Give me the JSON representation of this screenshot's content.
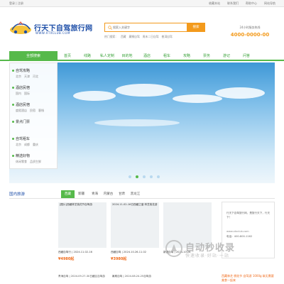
{
  "topbar": {
    "login": "登录 | 注册",
    "links": [
      "收藏本站",
      "联系我们",
      "帮助中心",
      "网站导航"
    ]
  },
  "logo": {
    "name": "行天下自驾旅行网",
    "url": "WWW.XTXCLUB.COM"
  },
  "search": {
    "placeholder": "搜索入关键字",
    "button": "搜索",
    "hot_label": "热门搜索：",
    "hot_terms": [
      "西藏",
      "藏桐自驾",
      "周末二日自驾",
      "普洱自驾"
    ]
  },
  "hotline": {
    "label": "24小时服务热线",
    "number": "4000-0000-00"
  },
  "nav": {
    "all_label": "全部搜索",
    "items": [
      "首页",
      "线路",
      "私人定制",
      "目的地",
      "酒店",
      "租车",
      "攻略",
      "票务",
      "游记",
      "问答"
    ]
  },
  "side_menu": [
    {
      "title": "自驾攻略",
      "subs": [
        "北京",
        "天津",
        "河北"
      ]
    },
    {
      "title": "酒店民宿",
      "subs": [
        "国内",
        "国际"
      ]
    },
    {
      "title": "酒店民宿",
      "subs": [
        "度假酒店",
        "民宿",
        "客栈"
      ]
    },
    {
      "title": "景点门票",
      "subs": []
    },
    {
      "title": "自驾租车",
      "subs": [
        "北京",
        "成都",
        "重庆"
      ]
    },
    {
      "title": "精选好物",
      "subs": [
        "休闲零食",
        "品质生鲜"
      ]
    }
  ],
  "section": {
    "title": "国内旅游",
    "tabs": [
      "西藏",
      "新疆",
      "青海",
      "内蒙古",
      "甘肃",
      "黑龙江"
    ],
    "active_tab": "西藏"
  },
  "cards": [
    {
      "caption": "[图片]西藏林芝桃花节自驾游",
      "desc": "西藏自驾行 | 2024.11.02-16",
      "price": "¥4980起"
    },
    {
      "caption": "2024.11.02-16日西藏之窗 林芝桃花游",
      "desc": "西藏自驾 | 2024.10.26-11.02",
      "price": "¥3980起"
    },
    {
      "caption": "",
      "desc": "新疆自驾 | 2024.10.26",
      "price": ""
    }
  ],
  "row2": [
    "青海自驾 | 2024.09.27-30日藏区自驾游",
    "暑期自驾 | 2024.08.24-25自驾游"
  ],
  "right_panel": {
    "text": "行天下自驾旅行网，是旅行天下，行天下！",
    "url": "www.xtxclub.com",
    "phone": "电话：400-800-1162"
  },
  "promo": "西藏林芝 桃花节 自驾游 1000g 碳无需要美食一起来",
  "watermark": {
    "main": "自动秒收录",
    "sub": "快速收录·好站·一站"
  },
  "colors": {
    "green": "#56b94a",
    "orange": "#f39a1c",
    "blue": "#1d4ea8"
  }
}
